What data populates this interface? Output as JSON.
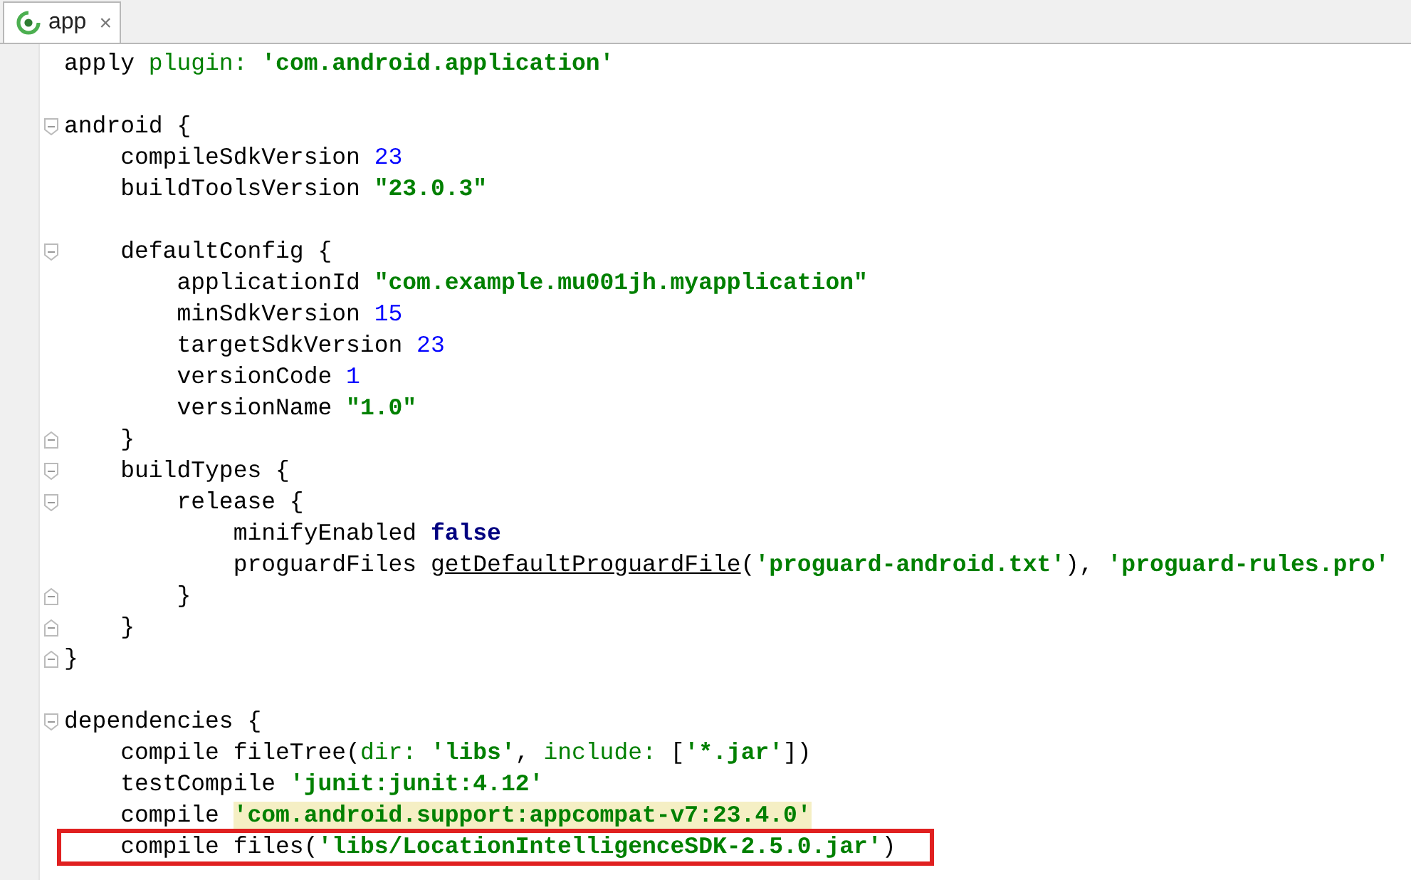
{
  "tabs": [
    {
      "label": "app",
      "selected": true,
      "close": "×"
    }
  ],
  "lines": [
    {
      "tokens": [
        {
          "text": "apply "
        },
        {
          "text": "plugin: ",
          "kind": "named"
        },
        {
          "text": "'com.android.application'",
          "kind": "string"
        }
      ]
    },
    {
      "gap_before": true,
      "fold_start": true,
      "tokens": [
        {
          "text": "android {"
        }
      ]
    },
    {
      "tokens": [
        {
          "text": "    compileSdkVersion "
        },
        {
          "text": "23",
          "kind": "number"
        }
      ]
    },
    {
      "tokens": [
        {
          "text": "    buildToolsVersion "
        },
        {
          "text": "\"23.0.3\"",
          "kind": "string"
        }
      ]
    },
    {
      "gap_before": true,
      "fold_start": true,
      "tokens": [
        {
          "text": "    defaultConfig {"
        }
      ]
    },
    {
      "tokens": [
        {
          "text": "        applicationId "
        },
        {
          "text": "\"com.example.mu001jh.myapplication\"",
          "kind": "string"
        }
      ]
    },
    {
      "tokens": [
        {
          "text": "        minSdkVersion "
        },
        {
          "text": "15",
          "kind": "number"
        }
      ]
    },
    {
      "tokens": [
        {
          "text": "        targetSdkVersion "
        },
        {
          "text": "23",
          "kind": "number"
        }
      ]
    },
    {
      "tokens": [
        {
          "text": "        versionCode "
        },
        {
          "text": "1",
          "kind": "number"
        }
      ]
    },
    {
      "tokens": [
        {
          "text": "        versionName "
        },
        {
          "text": "\"1.0\"",
          "kind": "string"
        }
      ]
    },
    {
      "fold_end": true,
      "tokens": [
        {
          "text": "    }"
        }
      ]
    },
    {
      "fold_start": true,
      "tokens": [
        {
          "text": "    buildTypes {"
        }
      ]
    },
    {
      "fold_start": true,
      "tokens": [
        {
          "text": "        release {"
        }
      ]
    },
    {
      "tokens": [
        {
          "text": "            minifyEnabled "
        },
        {
          "text": "false",
          "kind": "keyword"
        }
      ]
    },
    {
      "tokens": [
        {
          "text": "            proguardFiles "
        },
        {
          "text": "getDefaultProguardFile",
          "kind": "method"
        },
        {
          "text": "("
        },
        {
          "text": "'proguard-android.txt'",
          "kind": "string"
        },
        {
          "text": "), "
        },
        {
          "text": "'proguard-rules.pro'",
          "kind": "string"
        }
      ]
    },
    {
      "fold_end": true,
      "tokens": [
        {
          "text": "        }"
        }
      ]
    },
    {
      "fold_end": true,
      "tokens": [
        {
          "text": "    }"
        }
      ]
    },
    {
      "fold_end": true,
      "tokens": [
        {
          "text": "}"
        }
      ]
    },
    {
      "gap_before": true,
      "fold_start": true,
      "tokens": [
        {
          "text": "dependencies {"
        }
      ]
    },
    {
      "tokens": [
        {
          "text": "    compile fileTree("
        },
        {
          "text": "dir: ",
          "kind": "named"
        },
        {
          "text": "'libs'",
          "kind": "string"
        },
        {
          "text": ", "
        },
        {
          "text": "include: ",
          "kind": "named"
        },
        {
          "text": "["
        },
        {
          "text": "'*.jar'",
          "kind": "string"
        },
        {
          "text": "])"
        }
      ]
    },
    {
      "tokens": [
        {
          "text": "    testCompile "
        },
        {
          "text": "'junit:junit:4.12'",
          "kind": "string"
        }
      ]
    },
    {
      "tokens": [
        {
          "text": "    compile "
        },
        {
          "text": "'com.android.support:appcompat-v7:23.4.0'",
          "kind": "highlight"
        }
      ]
    },
    {
      "boxed": true,
      "tokens": [
        {
          "text": "    compile files("
        },
        {
          "text": "'libs/LocationIntelligenceSDK-2.5.0.jar'",
          "kind": "string"
        },
        {
          "text": ")"
        }
      ]
    }
  ]
}
